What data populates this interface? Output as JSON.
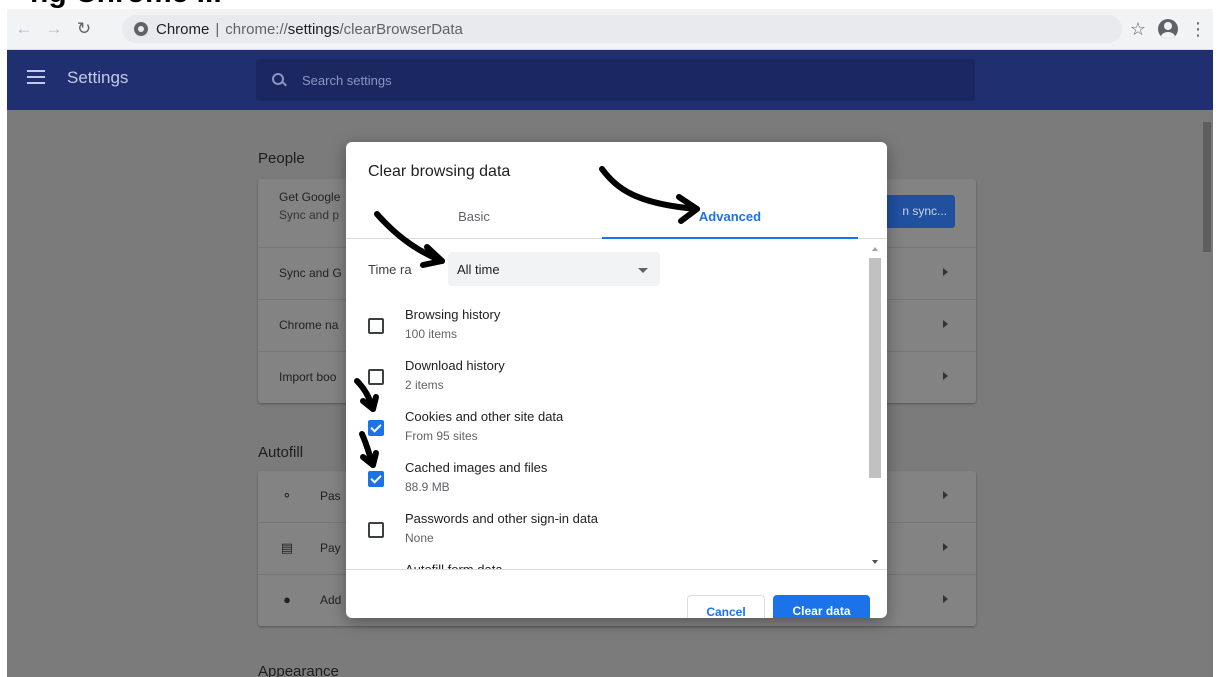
{
  "page_heading_partial": "ng Chrome ...",
  "toolbar": {
    "back_icon": "back-arrow-icon",
    "forward_icon": "forward-arrow-icon",
    "reload_icon": "reload-icon",
    "site_name": "Chrome",
    "url_scheme": "chrome://",
    "url_host": "settings",
    "url_path": "/clearBrowserData",
    "star_icon": "bookmark-star-icon",
    "account_icon": "account-icon",
    "menu_icon": "kebab-menu-icon"
  },
  "header": {
    "title": "Settings",
    "search_placeholder": "Search settings"
  },
  "settings_page": {
    "people_title": "People",
    "people_rows": [
      {
        "label": "Get Google",
        "sub": "Sync and p"
      },
      {
        "label": "Sync and G"
      },
      {
        "label": "Chrome na"
      },
      {
        "label": "Import boo"
      }
    ],
    "sync_button": "n sync...",
    "autofill_title": "Autofill",
    "autofill_rows": [
      {
        "label": "Pas",
        "icon": "key-icon"
      },
      {
        "label": "Pay",
        "icon": "credit-card-icon"
      },
      {
        "label": "Add",
        "icon": "location-pin-icon"
      }
    ],
    "appearance_title": "Appearance"
  },
  "dialog": {
    "title": "Clear browsing data",
    "tabs": [
      {
        "label": "Basic",
        "selected": false
      },
      {
        "label": "Advanced",
        "selected": true
      }
    ],
    "time_range_label": "Time ra",
    "time_range_value": "All time",
    "items": [
      {
        "name": "Browsing history",
        "detail": "100 items",
        "checked": false
      },
      {
        "name": "Download history",
        "detail": "2 items",
        "checked": false
      },
      {
        "name": "Cookies and other site data",
        "detail": "From 95 sites",
        "checked": true
      },
      {
        "name": "Cached images and files",
        "detail": "88.9 MB",
        "checked": true
      },
      {
        "name": "Passwords and other sign-in data",
        "detail": "None",
        "checked": false
      },
      {
        "name": "Autofill form data",
        "detail": "",
        "checked": false
      }
    ],
    "cancel_label": "Cancel",
    "clear_label": "Clear data"
  },
  "colors": {
    "accent": "#1a73e8",
    "header_bg": "#1f2f70",
    "annotation": "#000000"
  }
}
